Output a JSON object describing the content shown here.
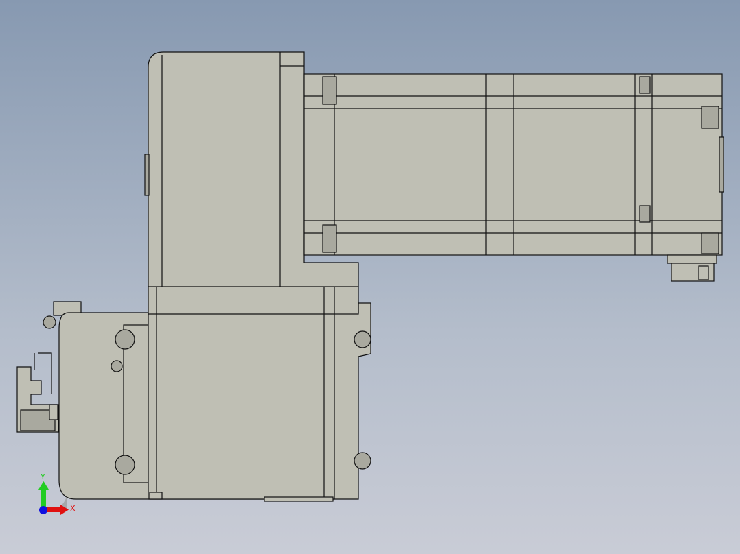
{
  "viewport": {
    "background_top": "#8799b1",
    "background_bottom": "#c9ccd6",
    "part_color": "#bfbfb4"
  },
  "triad": {
    "x_label": "X",
    "y_label": "Y",
    "x_color": "#e01010",
    "y_color": "#22cc22",
    "z_color": "#1010e0"
  }
}
